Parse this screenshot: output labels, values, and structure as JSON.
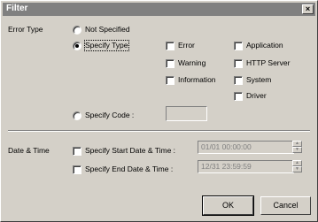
{
  "window": {
    "title": "Filter",
    "close_glyph": "×"
  },
  "error_type": {
    "group_label": "Error Type",
    "not_specified": "Not Specified",
    "specify_type": "Specify Type",
    "types": {
      "error": "Error",
      "warning": "Warning",
      "information": "Information",
      "application": "Application",
      "http_server": "HTTP Server",
      "system": "System",
      "driver": "Driver"
    },
    "specify_code": "Specify Code :",
    "code_value": ""
  },
  "date_time": {
    "group_label": "Date & Time",
    "start_label": "Specify Start Date & Time :",
    "start_value": "01/01 00:00:00",
    "end_label": "Specify End Date & Time :",
    "end_value": "12/31 23:59:59"
  },
  "buttons": {
    "ok": "OK",
    "cancel": "Cancel"
  }
}
